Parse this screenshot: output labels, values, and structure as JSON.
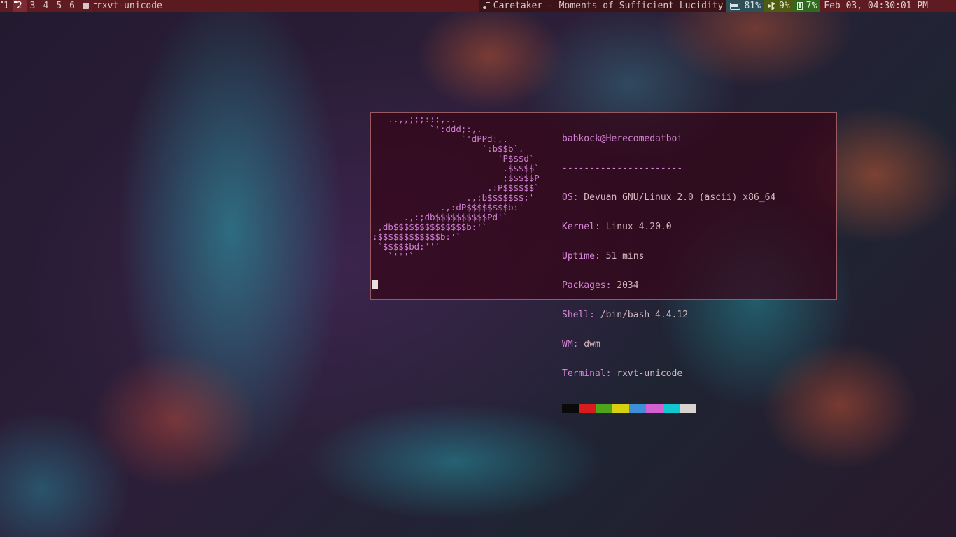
{
  "bar": {
    "tags": [
      {
        "label": "1",
        "selected": false,
        "occupied": true
      },
      {
        "label": "2",
        "selected": true,
        "occupied": true
      },
      {
        "label": "3",
        "selected": false,
        "occupied": false
      },
      {
        "label": "4",
        "selected": false,
        "occupied": false
      },
      {
        "label": "5",
        "selected": false,
        "occupied": false
      },
      {
        "label": "6",
        "selected": false,
        "occupied": false
      }
    ],
    "layout_icon": "layout-icon",
    "window_title": "rxvt-unicode",
    "now_playing": {
      "icon": "music-note-icon",
      "text": "Caretaker - Moments of Sufficient Lucidity"
    },
    "battery": {
      "icon": "battery-icon",
      "text": "81%"
    },
    "cpu": {
      "icon": "radiation-icon",
      "text": "9%"
    },
    "memory": {
      "icon": "memory-chip-icon",
      "text": "7%"
    },
    "clock": "Feb 03, 04:30:01 PM"
  },
  "terminal": {
    "logo_lines": [
      "   ..,,;;;::;,..",
      "           `':ddd;:,.",
      "                 `'dPPd:,.",
      "                     `:b$$b`.",
      "                        'P$$$d`",
      "                         .$$$$$`",
      "                         ;$$$$$P",
      "                      .:P$$$$$$`",
      "                  .,:b$$$$$$$;'",
      "             .,:dP$$$$$$$$b:'",
      "      .,:;db$$$$$$$$$$Pd'`",
      " ,db$$$$$$$$$$$$$$b:'`",
      ":$$$$$$$$$$$$b:'`",
      " `$$$$$bd:''`",
      "   `'''`"
    ],
    "user_host": "babkock@Herecomedatboi",
    "separator": "----------------------",
    "info": [
      {
        "key": "OS:",
        "value": " Devuan GNU/Linux 2.0 (ascii) x86_64"
      },
      {
        "key": "Kernel:",
        "value": " Linux 4.20.0"
      },
      {
        "key": "Uptime:",
        "value": " 51 mins"
      },
      {
        "key": "Packages:",
        "value": " 2034"
      },
      {
        "key": "Shell:",
        "value": " /bin/bash 4.4.12"
      },
      {
        "key": "WM:",
        "value": " dwm"
      },
      {
        "key": "Terminal:",
        "value": " rxvt-unicode"
      }
    ],
    "palette": [
      "#0a0a0a",
      "#d81c1c",
      "#4ea51a",
      "#d8cf10",
      "#3f8fd8",
      "#d35fd0",
      "#12c8d0",
      "#d8d3cf"
    ]
  }
}
